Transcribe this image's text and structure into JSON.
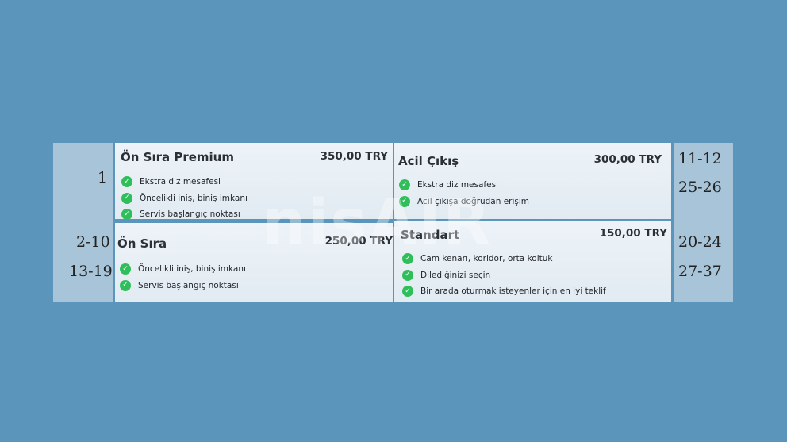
{
  "left_rows": [
    "1",
    "2-10",
    "13-19"
  ],
  "right_rows": [
    "11-12",
    "25-26",
    "20-24",
    "27-37"
  ],
  "watermark": "nisAIR",
  "colors": {
    "background": "#5b95bb",
    "side_panel": "#a8c4d8",
    "card": "#e8f0f6",
    "check": "#2fbf5a"
  },
  "fares": {
    "front_premium": {
      "title": "Ön Sıra Premium",
      "price": "350,00 TRY",
      "features": [
        "Ekstra diz mesafesi",
        "Öncelikli iniş, biniş imkanı",
        "Servis başlangıç noktası"
      ]
    },
    "emergency_exit": {
      "title": "Acil Çıkış",
      "price": "300,00 TRY",
      "features": [
        "Ekstra diz mesafesi",
        "Acil çıkışa doğrudan erişim"
      ]
    },
    "front": {
      "title": "Ön Sıra",
      "price": "250,00 TRY",
      "features": [
        "Öncelikli iniş, biniş imkanı",
        "Servis başlangıç noktası"
      ]
    },
    "standard": {
      "title": "Standart",
      "price": "150,00 TRY",
      "features": [
        "Cam kenarı, koridor, orta koltuk",
        "Dilediğinizi seçin",
        "Bir arada oturmak isteyenler için en iyi teklif"
      ]
    }
  }
}
